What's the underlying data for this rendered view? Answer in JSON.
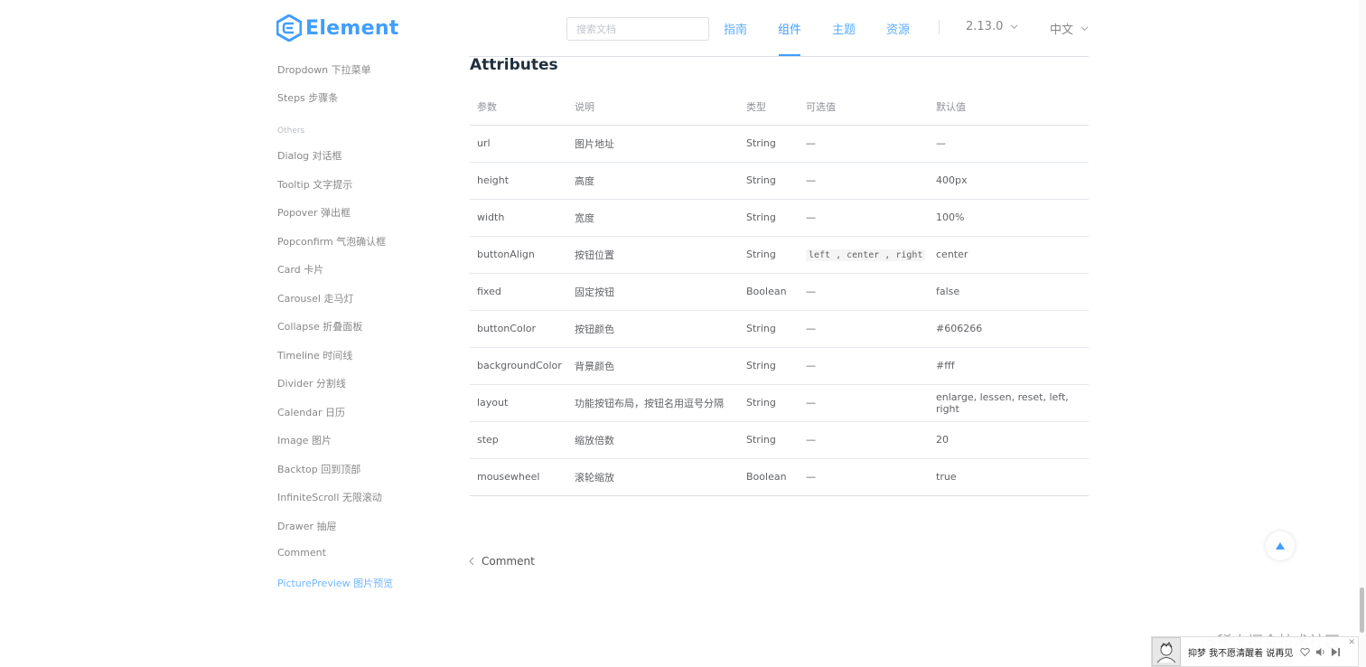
{
  "header": {
    "logo_text": "Element",
    "search_placeholder": "搜索文档",
    "nav": [
      "指南",
      "组件",
      "主题",
      "资源"
    ],
    "version": "2.13.0",
    "language": "中文"
  },
  "sidebar": {
    "items_top": [
      "Dropdown 下拉菜单",
      "Steps 步骤条"
    ],
    "group_label": "Others",
    "items": [
      "Dialog 对话框",
      "Tooltip 文字提示",
      "Popover 弹出框",
      "Popconfirm 气泡确认框",
      "Card 卡片",
      "Carousel 走马灯",
      "Collapse 折叠面板",
      "Timeline 时间线",
      "Divider 分割线",
      "Calendar 日历",
      "Image 图片",
      "Backtop 回到顶部",
      "InfiniteScroll 无限滚动",
      "Drawer 抽屉",
      "Comment",
      "PicturePreview 图片预览"
    ]
  },
  "main": {
    "section_title": "Attributes",
    "table": {
      "headers": [
        "参数",
        "说明",
        "类型",
        "可选值",
        "默认值"
      ],
      "rows": [
        [
          "url",
          "图片地址",
          "String",
          "—",
          "—"
        ],
        [
          "height",
          "高度",
          "String",
          "—",
          "400px"
        ],
        [
          "width",
          "宽度",
          "String",
          "—",
          "100%"
        ],
        [
          "buttonAlign",
          "按钮位置",
          "String",
          "left , center , right",
          "center"
        ],
        [
          "fixed",
          "固定按钮",
          "Boolean",
          "—",
          "false"
        ],
        [
          "buttonColor",
          "按钮颜色",
          "String",
          "—",
          "#606266"
        ],
        [
          "backgroundColor",
          "背景颜色",
          "String",
          "—",
          "#fff"
        ],
        [
          "layout",
          "功能按钮布局，按钮名用逗号分隔",
          "String",
          "—",
          "enlarge, lessen, reset, left, right"
        ],
        [
          "step",
          "缩放倍数",
          "String",
          "—",
          "20"
        ],
        [
          "mousewheel",
          "滚轮缩放",
          "Boolean",
          "—",
          "true"
        ]
      ]
    },
    "prev_link": "Comment"
  },
  "overlay": {
    "watermark": "@稀土掘金技术社区",
    "player_text": "抑梦  我不愿清醒着  说再见"
  },
  "colors": {
    "accent": "#409eff",
    "text": "#606266",
    "heading": "#1f2f3d",
    "border": "#dcdfe6"
  }
}
